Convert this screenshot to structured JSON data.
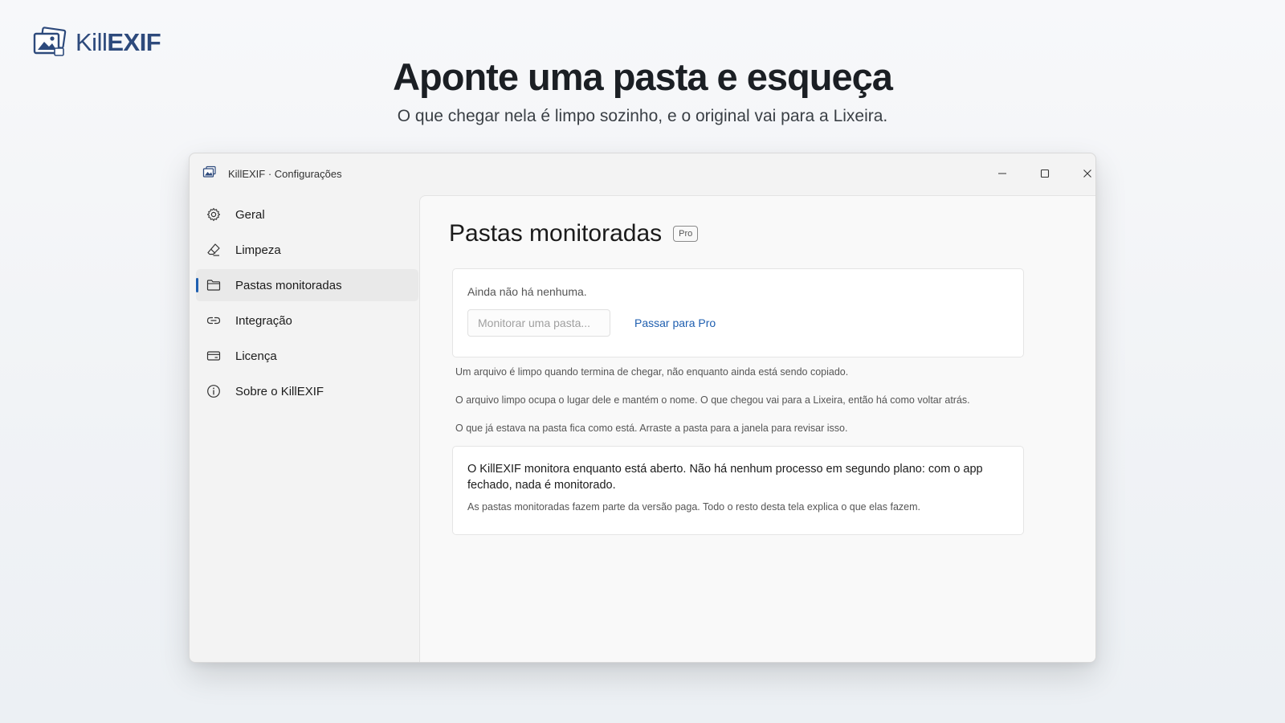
{
  "brand": {
    "name_part1": "Kill",
    "name_part2": "EXIF",
    "accent_color": "#2d4a7c"
  },
  "hero": {
    "title": "Aponte uma pasta e esqueça",
    "subtitle": "O que chegar nela é limpo sozinho, e o original vai para a Lixeira."
  },
  "window": {
    "title": "KillEXIF · Configurações",
    "controls": {
      "minimize_icon": "minimize-icon",
      "maximize_icon": "maximize-icon",
      "close_icon": "close-icon"
    }
  },
  "sidebar": {
    "items": [
      {
        "label": "Geral",
        "icon": "gear-icon",
        "selected": false
      },
      {
        "label": "Limpeza",
        "icon": "eraser-icon",
        "selected": false
      },
      {
        "label": "Pastas monitoradas",
        "icon": "folder-icon",
        "selected": true
      },
      {
        "label": "Integração",
        "icon": "link-icon",
        "selected": false
      },
      {
        "label": "Licença",
        "icon": "card-icon",
        "selected": false
      },
      {
        "label": "Sobre o KillEXIF",
        "icon": "info-icon",
        "selected": false
      }
    ],
    "selected_indicator_color": "#1f5fb0"
  },
  "main": {
    "page_title": "Pastas monitoradas",
    "badge": "Pro",
    "folders_card": {
      "empty_text": "Ainda não há nenhuma.",
      "input_placeholder": "Monitorar uma pasta...",
      "pro_link": "Passar para Pro"
    },
    "notes": [
      "Um arquivo é limpo quando termina de chegar, não enquanto ainda está sendo copiado.",
      "O arquivo limpo ocupa o lugar dele e mantém o nome. O que chegou vai para a Lixeira, então há como voltar atrás.",
      "O que já estava na pasta fica como está. Arraste a pasta para a janela para revisar isso."
    ],
    "info_card": {
      "main_text": "O KillEXIF monitora enquanto está aberto. Não há nenhum processo em segundo plano: com o app fechado, nada é monitorado.",
      "sub_text": "As pastas monitoradas fazem parte da versão paga. Todo o resto desta tela explica o que elas fazem."
    },
    "link_color": "#1f5fb0"
  }
}
